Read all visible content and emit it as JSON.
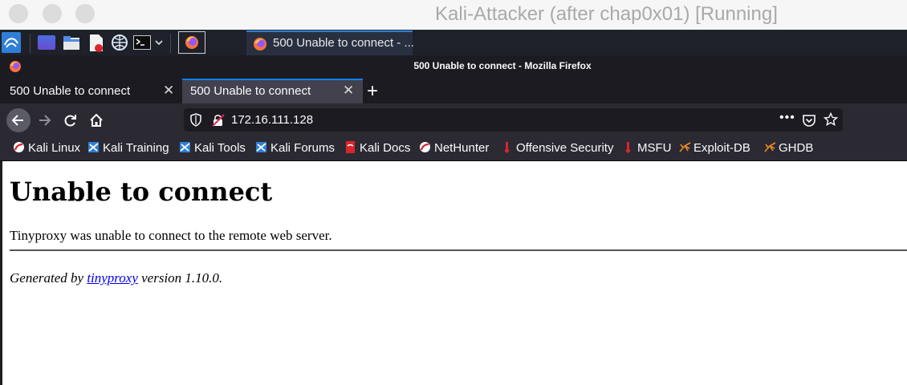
{
  "vm_window": {
    "title": "Kali-Attacker (after chap0x01) [Running]"
  },
  "kali_panel": {
    "apps": [
      "kali-menu-icon",
      "desktop-icon",
      "file-manager-icon",
      "text-editor-icon",
      "browser-icon",
      "terminal-icon"
    ],
    "active_task": {
      "label": "500 Unable to connect - ..."
    }
  },
  "firefox": {
    "window_title": "500 Unable to connect - Mozilla Firefox",
    "tabs": [
      {
        "label": "500 Unable to connect",
        "active": false
      },
      {
        "label": "500 Unable to connect",
        "active": true
      }
    ],
    "url": "172.16.111.128",
    "bookmarks": [
      {
        "label": "Kali Linux",
        "icon": "kali-icon"
      },
      {
        "label": "Kali Training",
        "icon": "kali-training-icon"
      },
      {
        "label": "Kali Tools",
        "icon": "kali-tools-icon"
      },
      {
        "label": "Kali Forums",
        "icon": "kali-forums-icon"
      },
      {
        "label": "Kali Docs",
        "icon": "kali-docs-icon"
      },
      {
        "label": "NetHunter",
        "icon": "nethunter-icon"
      },
      {
        "label": "Offensive Security",
        "icon": "offsec-icon"
      },
      {
        "label": "MSFU",
        "icon": "msfu-icon"
      },
      {
        "label": "Exploit-DB",
        "icon": "exploitdb-icon"
      },
      {
        "label": "GHDB",
        "icon": "ghdb-icon"
      }
    ]
  },
  "page": {
    "heading": "Unable to connect",
    "message": "Tinyproxy was unable to connect to the remote web server.",
    "footer_prefix": "Generated by",
    "footer_link": "tinyproxy",
    "footer_suffix": "version 1.10.0."
  },
  "colors": {
    "panel_bg": "#1e2129",
    "firefox_dark": "#1c1b22",
    "toolbar": "#2b2a33",
    "active_tab": "#42414d",
    "accent_blue": "#0a84ff",
    "link": "#0000ee"
  }
}
